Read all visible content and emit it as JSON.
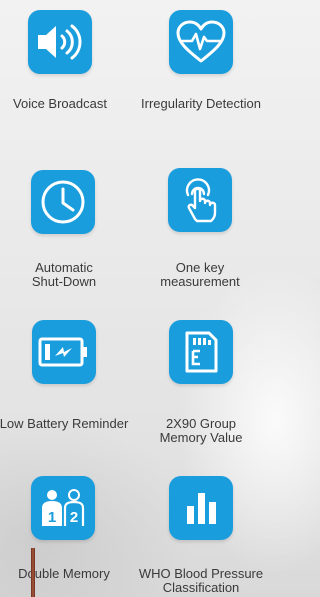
{
  "features": [
    {
      "id": "voice_broadcast",
      "label": "Voice Broadcast",
      "icon": "speaker-icon"
    },
    {
      "id": "irregularity_detection",
      "label": "Irregularity Detection",
      "icon": "heart-pulse-icon"
    },
    {
      "id": "automatic_shutdown",
      "label_lines": [
        "Automatic",
        "Shut-Down"
      ],
      "icon": "clock-icon"
    },
    {
      "id": "one_key_measurement",
      "label_lines": [
        "One key",
        "measurement"
      ],
      "icon": "touch-hand-icon"
    },
    {
      "id": "low_battery_reminder",
      "label": "Low Battery Reminder",
      "icon": "battery-icon"
    },
    {
      "id": "memory_value",
      "label_lines": [
        "2X90 Group",
        "Memory Value"
      ],
      "icon": "memory-card-icon"
    },
    {
      "id": "double_memory",
      "label": "Double Memory",
      "icon": "two-users-icon"
    },
    {
      "id": "who_classification",
      "label_lines": [
        "WHO Blood Pressure",
        "Classification"
      ],
      "icon": "bar-chart-icon"
    }
  ],
  "colors": {
    "tile": "#1a9ddd",
    "icon": "#ffffff",
    "label": "#3a3a3a"
  }
}
